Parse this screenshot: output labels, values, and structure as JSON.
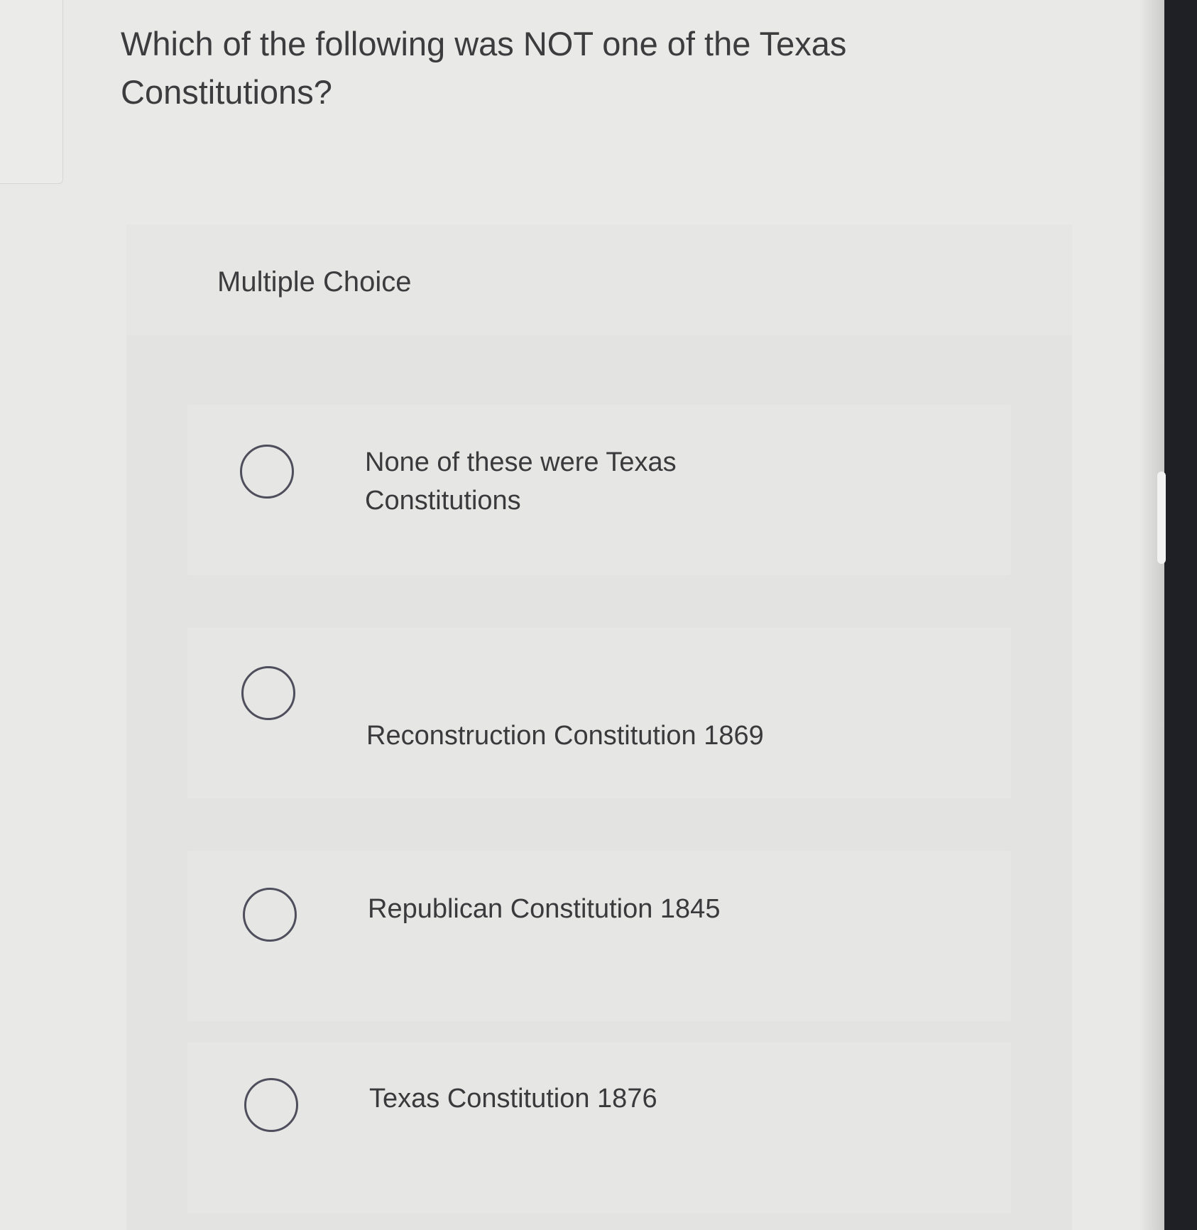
{
  "question": {
    "text": "Which of the following was NOT one of the Texas Constitutions?"
  },
  "multiple_choice": {
    "label": "Multiple Choice",
    "options": [
      {
        "text": "None of these were Texas Constitutions",
        "selected": false
      },
      {
        "text": "Reconstruction Constitution 1869",
        "selected": false
      },
      {
        "text": "Republican Constitution 1845",
        "selected": false
      },
      {
        "text": "Texas Constitution 1876",
        "selected": false
      }
    ]
  },
  "colors": {
    "page_background": "#e9e9e7",
    "panel_background": "#e3e3e1",
    "text": "#3c3c3e",
    "radio_border": "#4e4e5c",
    "scrollbar": "#1f2025"
  }
}
